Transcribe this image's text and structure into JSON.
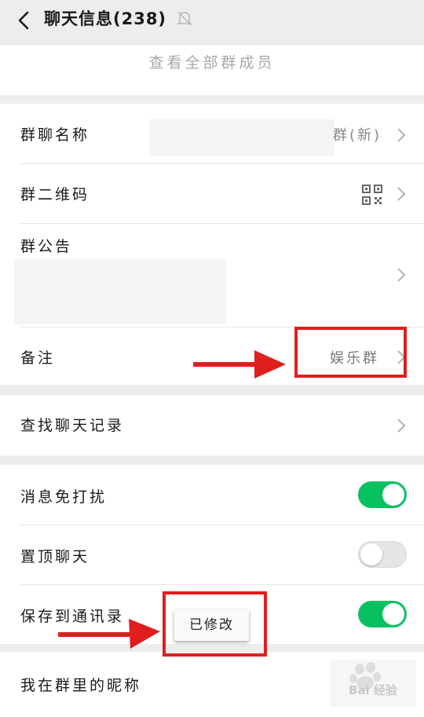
{
  "header": {
    "title": "聊天信息(238)"
  },
  "members": {
    "view_all": "查看全部群成员"
  },
  "group_info": {
    "name_label": "群聊名称",
    "name_value": "群(新)",
    "qrcode_label": "群二维码",
    "announcement_label": "群公告",
    "remark_label": "备注",
    "remark_value": "娱乐群"
  },
  "search": {
    "label": "查找聊天记录"
  },
  "settings": {
    "mute_label": "消息免打扰",
    "mute_on": true,
    "pin_label": "置顶聊天",
    "pin_on": false,
    "save_label": "保存到通讯录",
    "save_on": true
  },
  "nickname": {
    "label": "我在群里的昵称"
  },
  "toast": {
    "text": "已修改"
  },
  "watermark": {
    "text": "Bai 经验"
  },
  "colors": {
    "toggle_on": "#07c160",
    "annotation_red": "#e01e1e",
    "background": "#ededed"
  }
}
